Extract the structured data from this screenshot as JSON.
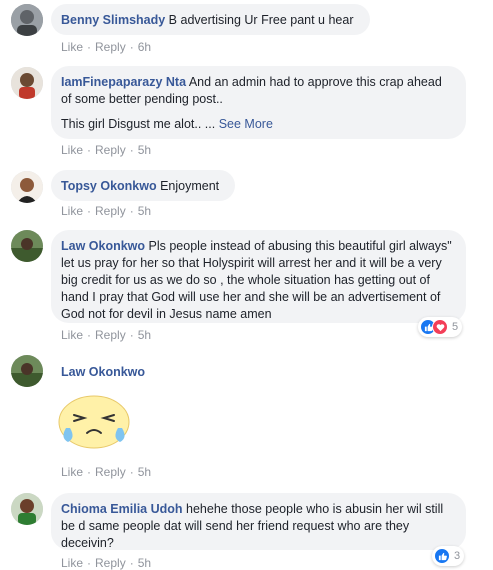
{
  "comments": [
    {
      "author": "Benny Slimshady",
      "text": " B advertising Ur Free pant u hear",
      "like": "Like",
      "reply": "Reply",
      "time": "6h"
    },
    {
      "author": "IamFinepaparazy Nta",
      "text": " And an admin had to approve this crap ahead of some better pending post..",
      "text2": "This girl Disgust me alot.. ...",
      "see_more": "See More",
      "like": "Like",
      "reply": "Reply",
      "time": "5h"
    },
    {
      "author": "Topsy Okonkwo",
      "text": " Enjoyment",
      "like": "Like",
      "reply": "Reply",
      "time": "5h"
    },
    {
      "author": "Law Okonkwo",
      "text": " Pls people instead of abusing this beautiful girl always\" let us pray for her so that Holyspirit will arrest her and it will be a very big credit for us as we do so , the whole situation has getting out of hand I pray that God will use her and she will be an advertisement of God not for devil in Jesus name amen",
      "like": "Like",
      "reply": "Reply",
      "time": "5h",
      "reaction_count": "5"
    },
    {
      "author": "Law Okonkwo",
      "like": "Like",
      "reply": "Reply",
      "time": "5h"
    },
    {
      "author": "Chioma Emilia Udoh",
      "text": " hehehe those people who is abusin her wil still be d same people dat will send her friend request who are they deceivin?",
      "like": "Like",
      "reply": "Reply",
      "time": "5h",
      "reaction_count": "3"
    }
  ],
  "colors": {
    "author": "#385898",
    "bubble": "#f2f3f5",
    "meta": "#90949c",
    "like_reaction": "#1877f2",
    "love_reaction": "#f33e58"
  }
}
